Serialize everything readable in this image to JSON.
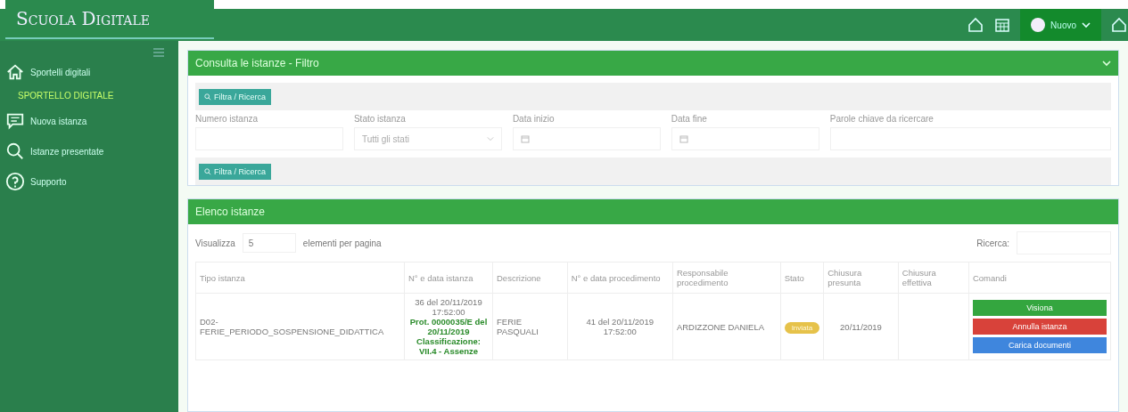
{
  "header": {
    "logo": "Scuola Digitale",
    "user": "Nuovo"
  },
  "sidebar": {
    "items": [
      {
        "kind": "home",
        "label": "Sportelli digitali"
      },
      {
        "kind": "section",
        "label": "SPORTELLO DIGITALE"
      },
      {
        "kind": "request",
        "label": "Nuova istanza"
      },
      {
        "kind": "search",
        "label": "Istanze presentate"
      },
      {
        "kind": "help",
        "label": "Supporto"
      }
    ]
  },
  "filter_panel": {
    "title": "Consulta le istanze - Filtro",
    "button_top": "Filtra / Ricerca",
    "button_bottom": "Filtra / Ricerca",
    "fields": [
      {
        "kind": "text",
        "label": "Numero istanza"
      },
      {
        "kind": "select",
        "label": "Stato istanza",
        "value": "Tutti gli stati"
      },
      {
        "kind": "date",
        "label": "Data inizio"
      },
      {
        "kind": "date",
        "label": "Data fine"
      },
      {
        "kind": "text",
        "label": "Parole chiave da ricercare"
      }
    ]
  },
  "list_panel": {
    "title": "Elenco istanze",
    "show_label": "Visualizza",
    "page_size": "5",
    "page_size_suffix": "elementi per pagina",
    "search_label": "Ricerca:",
    "table": {
      "columns": [
        "Tipo istanza",
        "N° e data istanza",
        "Descrizione",
        "N° e data procedimento",
        "Responsabile procedimento",
        "Stato",
        "Chiusura presunta",
        "Chiusura effettiva",
        "Comandi"
      ],
      "rows": [
        {
          "tipo": "D02-FERIE_PERIODO_SOSPENSIONE_DIDATTICA",
          "numero": "36 del 20/11/2019 17:52:00",
          "protocollo": "Prot. 0000035/E del 20/11/2019 Classificazione: VII.4 - Assenze",
          "descrizione": "FERIE PASQUALI",
          "procedimento": "41 del 20/11/2019 17:52:00",
          "responsabile": "ARDIZZONE DANIELA",
          "stato": "Inviata",
          "chiusura_presunta": "20/11/2019",
          "actions": [
            {
              "kind": "view",
              "label": "Visiona"
            },
            {
              "kind": "cancel",
              "label": "Annulla istanza"
            },
            {
              "kind": "upload",
              "label": "Carica documenti"
            }
          ]
        }
      ]
    }
  }
}
